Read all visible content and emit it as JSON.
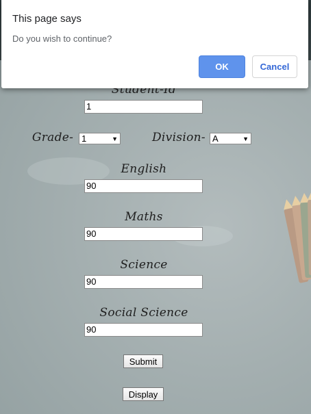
{
  "dialog": {
    "title": "This page says",
    "message": "Do you wish to continue?",
    "ok_label": "OK",
    "cancel_label": "Cancel"
  },
  "form": {
    "student_id": {
      "label": "Student-Id",
      "value": "1"
    },
    "grade": {
      "label": "Grade-",
      "selected": "1"
    },
    "division": {
      "label": "Division-",
      "selected": "A"
    },
    "english": {
      "label": "English",
      "value": "90"
    },
    "maths": {
      "label": "Maths",
      "value": "90"
    },
    "science": {
      "label": "Science",
      "value": "90"
    },
    "social_science": {
      "label": "Social Science",
      "value": "90"
    },
    "submit_label": "Submit",
    "display_label": "Display"
  },
  "colors": {
    "dialog_ok": "#5f93ec",
    "dialog_cancel_text": "#3367d6",
    "board": "#a4afb0"
  }
}
